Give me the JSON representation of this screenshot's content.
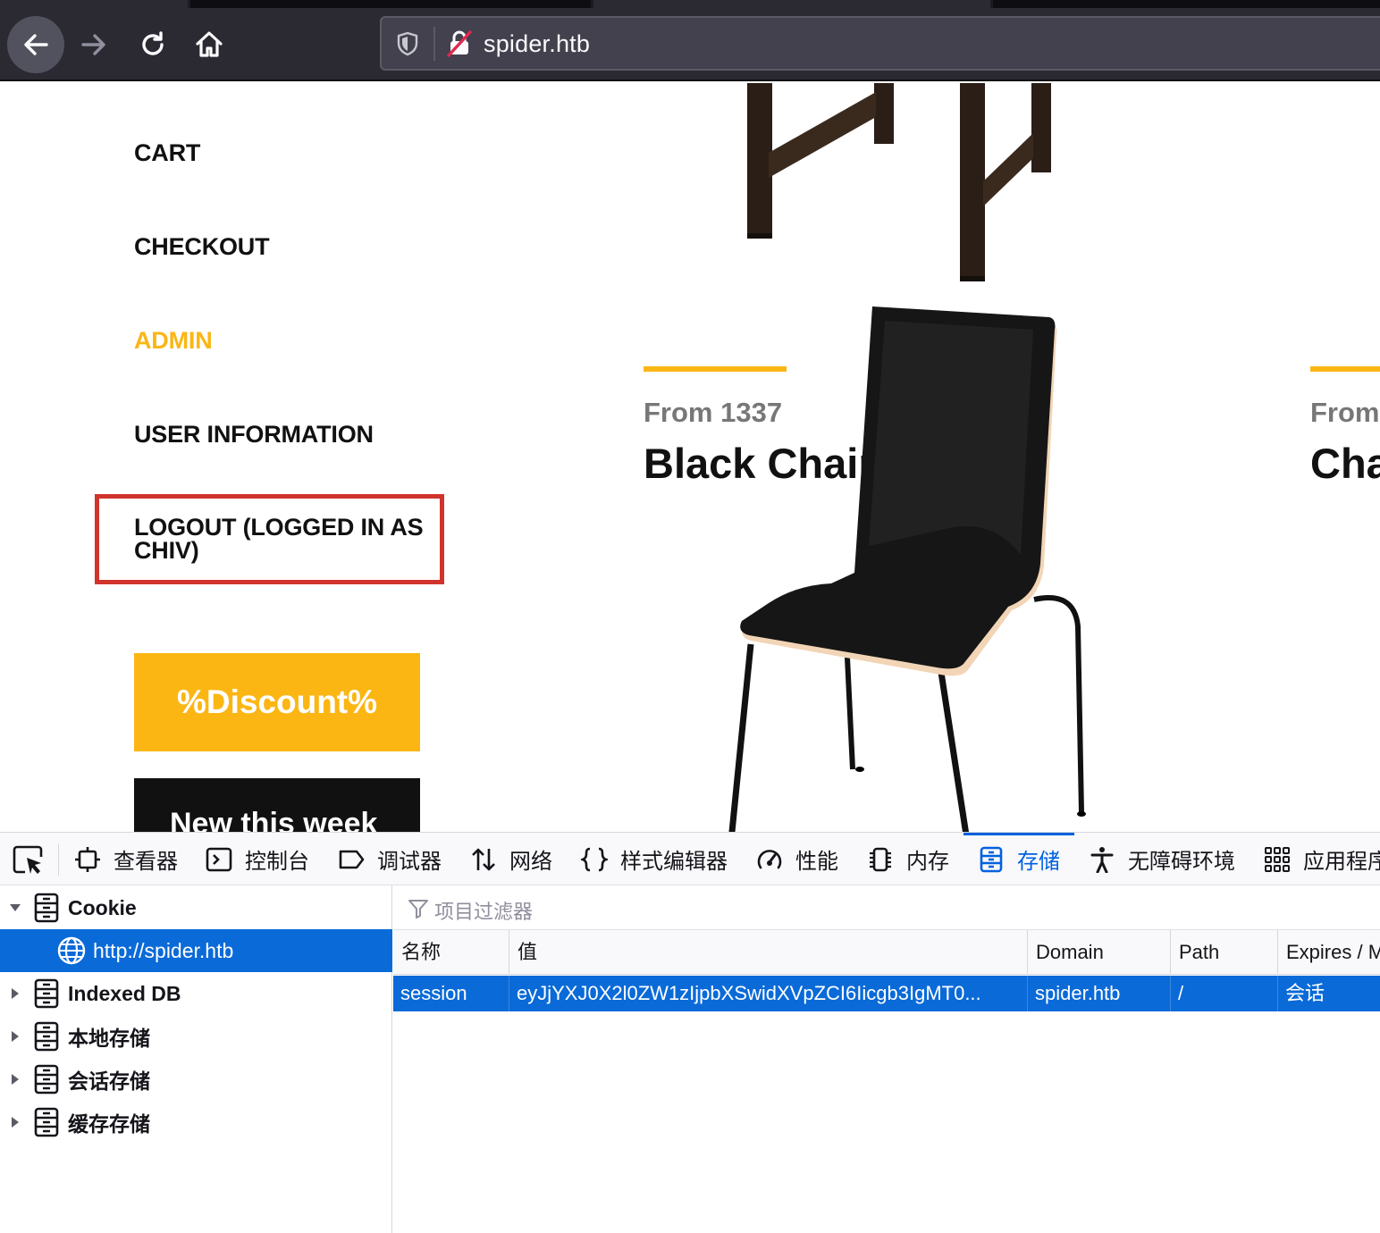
{
  "browser": {
    "url": "spider.htb"
  },
  "nav": {
    "cart": "CART",
    "checkout": "CHECKOUT",
    "admin": "ADMIN",
    "user_information": "USER INFORMATION",
    "logout": "LOGOUT (LOGGED IN AS CHIV)"
  },
  "promo": {
    "discount": "%Discount%",
    "new_this_week": "New this week"
  },
  "products": [
    {
      "price": "From 1337",
      "name": "Black Chair"
    },
    {
      "price": "From",
      "name": "Cha"
    }
  ],
  "colors": {
    "accent": "#fbb614",
    "highlight_box": "#d0342c",
    "devtools_selected": "#0a6ad8"
  },
  "devtools": {
    "tabs": [
      {
        "label": "查看器",
        "icon": "inspector-icon"
      },
      {
        "label": "控制台",
        "icon": "console-icon"
      },
      {
        "label": "调试器",
        "icon": "debugger-icon"
      },
      {
        "label": "网络",
        "icon": "network-icon"
      },
      {
        "label": "样式编辑器",
        "icon": "style-editor-icon"
      },
      {
        "label": "性能",
        "icon": "performance-icon"
      },
      {
        "label": "内存",
        "icon": "memory-icon"
      },
      {
        "label": "存储",
        "icon": "storage-icon",
        "active": true
      },
      {
        "label": "无障碍环境",
        "icon": "accessibility-icon"
      },
      {
        "label": "应用程序",
        "icon": "application-icon"
      }
    ],
    "tree": {
      "cookie": "Cookie",
      "cookie_host": "http://spider.htb",
      "indexed_db": "Indexed DB",
      "local_storage": "本地存储",
      "session_storage": "会话存储",
      "cache_storage": "缓存存储"
    },
    "filter_placeholder": "项目过滤器",
    "table": {
      "headers": [
        "名称",
        "值",
        "Domain",
        "Path",
        "Expires / M"
      ],
      "rows": [
        [
          "session",
          "eyJjYXJ0X2l0ZW1zIjpbXSwidXVpZCI6Iicgb3IgMT0...",
          "spider.htb",
          "/",
          "会话"
        ]
      ]
    }
  }
}
